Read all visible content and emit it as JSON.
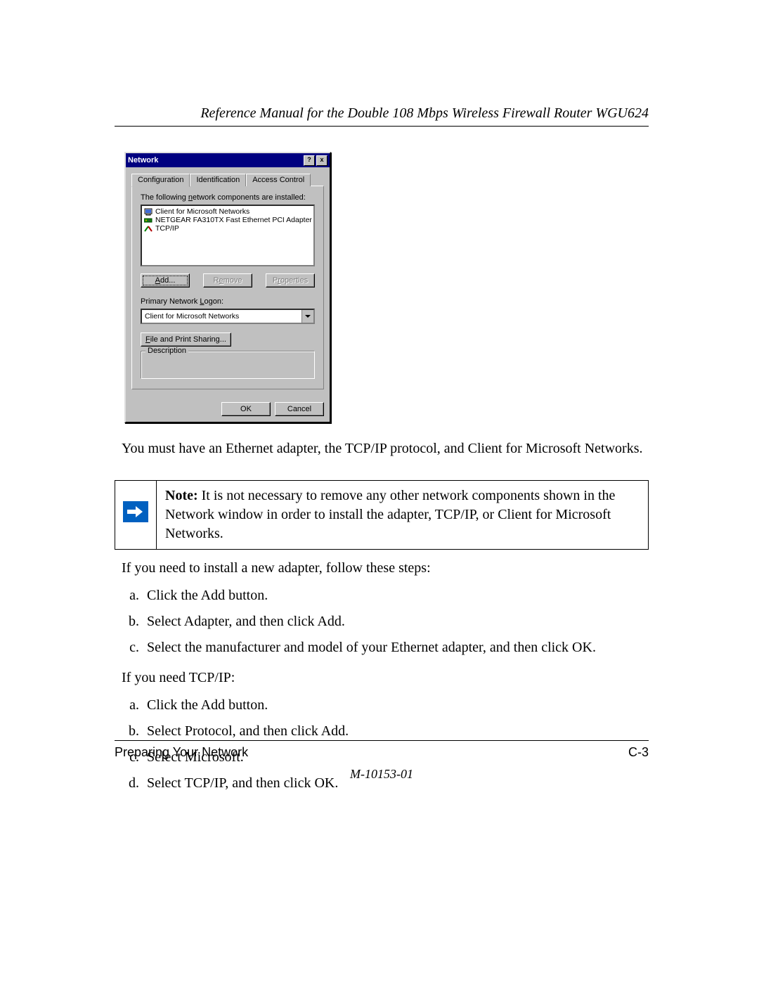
{
  "header": {
    "title": "Reference Manual for the Double 108 Mbps Wireless Firewall Router WGU624"
  },
  "dialog": {
    "title": "Network",
    "help_btn": "?",
    "close_btn": "x",
    "tabs": {
      "configuration": "Configuration",
      "identification": "Identification",
      "access_control": "Access Control"
    },
    "components_label": "The following network components are installed:",
    "components": {
      "client": "Client for Microsoft Networks",
      "adapter": "NETGEAR FA310TX Fast Ethernet PCI Adapter",
      "tcpip": "TCP/IP"
    },
    "buttons": {
      "add": "Add...",
      "remove": "Remove",
      "properties": "Properties"
    },
    "primary_logon_label": "Primary Network Logon:",
    "primary_logon_value": "Client for Microsoft Networks",
    "file_print_sharing": "File and Print Sharing...",
    "description_legend": "Description",
    "ok": "OK",
    "cancel": "Cancel"
  },
  "body": {
    "after_dialog": "You must have an Ethernet adapter, the TCP/IP protocol, and Client for Microsoft Networks.",
    "note_label": "Note:",
    "note_text": " It is not necessary to remove any other network components shown in the Network window in order to install the adapter, TCP/IP, or Client for Microsoft Networks.",
    "adapter_intro": "If you need to install a new adapter, follow these steps:",
    "adapter_steps": {
      "a": "Click the Add button.",
      "b": "Select Adapter, and then click Add.",
      "c": "Select the manufacturer and model of your Ethernet adapter, and then click OK."
    },
    "tcpip_intro": "If you need TCP/IP:",
    "tcpip_steps": {
      "a": "Click the Add button.",
      "b": "Select Protocol, and then click Add.",
      "c": "Select Microsoft.",
      "d": "Select TCP/IP, and then click OK."
    }
  },
  "footer": {
    "section": "Preparing Your Network",
    "page": "C-3",
    "doc_number": "M-10153-01"
  }
}
